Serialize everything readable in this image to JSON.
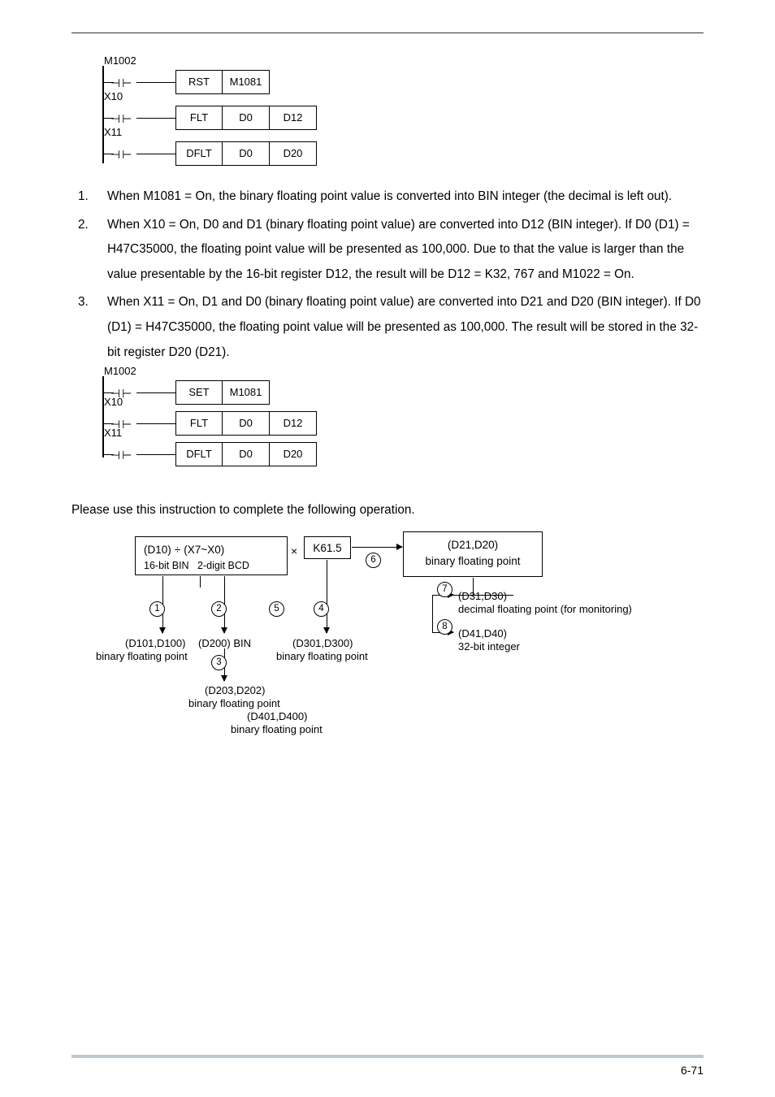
{
  "ladder1": {
    "rows": [
      {
        "contact": "M1002",
        "ops": [
          "RST",
          "M1081"
        ]
      },
      {
        "contact": "X10",
        "ops": [
          "FLT",
          "D0",
          "D12"
        ]
      },
      {
        "contact": "X11",
        "ops": [
          "DFLT",
          "D0",
          "D20"
        ]
      }
    ]
  },
  "explain": [
    "When M1081 = On, the binary floating point value is converted into BIN integer (the decimal is left out).",
    "When X10 = On, D0 and D1 (binary floating point value) are converted into D12 (BIN integer). If D0 (D1) = H47C35000, the floating point value will be presented as 100,000. Due to that the value is larger than the value presentable by the 16-bit register D12, the result will be D12 = K32, 767 and M1022 = On.",
    "When X11 = On, D1 and D0 (binary floating point value) are converted into D21 and D20 (BIN integer). If D0 (D1) = H47C35000, the floating point value will be presented as 100,000. The result will be stored in the 32-bit register D20 (D21)."
  ],
  "ladder2": {
    "rows": [
      {
        "contact": "M1002",
        "ops": [
          "SET",
          "M1081"
        ]
      },
      {
        "contact": "X10",
        "ops": [
          "FLT",
          "D0",
          "D12"
        ]
      },
      {
        "contact": "X11",
        "ops": [
          "DFLT",
          "D0",
          "D20"
        ]
      }
    ]
  },
  "final_note": "Please use this instruction to complete the following operation.",
  "flow": {
    "box1_l1": "(D10)",
    "box1_div": "÷",
    "box1_l2": "(X7~X0)",
    "box1_sub1": "16-bit BIN",
    "box1_sub2": "2-digit BCD",
    "k615": "K61.5",
    "times": "×",
    "box_d21_l1": "(D21,D20)",
    "box_d21_l2": "binary floating point",
    "d101_l1": "(D101,D100)",
    "d101_l2": "binary floating point",
    "d200": "(D200) BIN",
    "d301_l1": "(D301,D300)",
    "d301_l2": "binary floating point",
    "d203_l1": "(D203,D202)",
    "d203_l2": "binary floating point",
    "d401_l1": "(D401,D400)",
    "d401_l2": "binary floating point",
    "d31_l1": "(D31,D30)",
    "d31_l2": "decimal floating point (for monitoring)",
    "d41_l1": "(D41,D40)",
    "d41_l2": "32-bit integer",
    "n1": "1",
    "n2": "2",
    "n3": "3",
    "n4": "4",
    "n5": "5",
    "n6": "6",
    "n7": "7",
    "n8": "8"
  },
  "page_number": "6-71"
}
